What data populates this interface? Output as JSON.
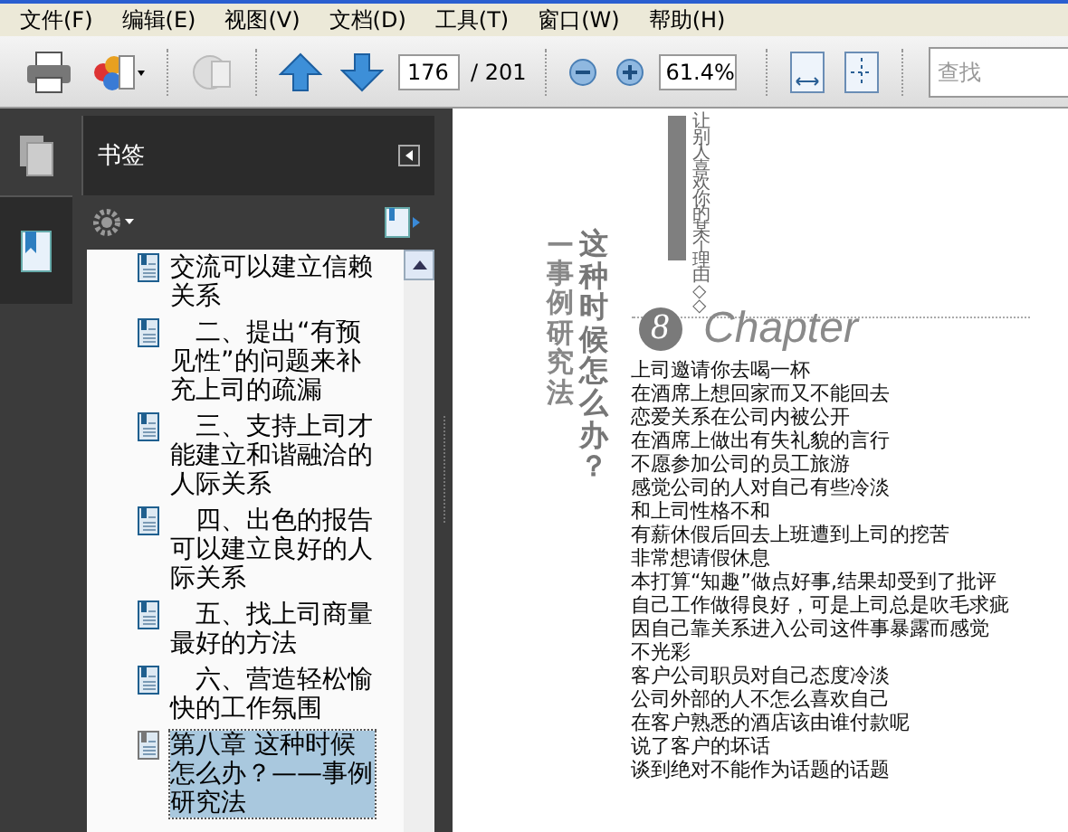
{
  "menu": [
    {
      "label": "文件(F)"
    },
    {
      "label": "编辑(E)"
    },
    {
      "label": "视图(V)"
    },
    {
      "label": "文档(D)"
    },
    {
      "label": "工具(T)"
    },
    {
      "label": "窗口(W)"
    },
    {
      "label": "帮助(H)"
    }
  ],
  "toolbar": {
    "page_number": "176",
    "page_total": "/ 201",
    "zoom": "61.4%",
    "search": {
      "placeholder": "查找"
    }
  },
  "nav_panel": [
    {
      "kind": "pages",
      "selected": false
    },
    {
      "kind": "bookmarks",
      "selected": true
    }
  ],
  "bookmarks_panel": {
    "title": "书签",
    "items": [
      {
        "label": "交流可以建立信赖关系",
        "indent": false,
        "selected": false
      },
      {
        "label": "二、提出“有预见性”的问题来补充上司的疏漏",
        "indent": true,
        "selected": false
      },
      {
        "label": "三、支持上司才能建立和谐融洽的人际关系",
        "indent": true,
        "selected": false
      },
      {
        "label": "四、出色的报告可以建立良好的人际关系",
        "indent": true,
        "selected": false
      },
      {
        "label": "五、找上司商量最好的方法",
        "indent": true,
        "selected": false
      },
      {
        "label": "六、营造轻松愉快的工作氛围",
        "indent": true,
        "selected": false
      },
      {
        "label": "第八章 这种时候怎么办？——事例研究法",
        "indent": false,
        "selected": true
      }
    ]
  },
  "page": {
    "side_note": "让别人喜欢你的某个理由◇◇",
    "title": "这种时候怎么办？",
    "subtitle": "—事例研究法",
    "chapter_number": "8",
    "chapter_label": "Chapter",
    "lines": [
      "上司邀请你去喝一杯",
      "在酒席上想回家而又不能回去",
      "恋爱关系在公司内被公开",
      "在酒席上做出有失礼貌的言行",
      "不愿参加公司的员工旅游",
      "感觉公司的人对自己有些冷淡",
      "和上司性格不和",
      "有薪休假后回去上班遭到上司的挖苦",
      "非常想请假休息",
      "本打算“知趣”做点好事,结果却受到了批评",
      "自己工作做得良好，可是上司总是吹毛求疵",
      "因自己靠关系进入公司这件事暴露而感觉",
      "不光彩",
      "客户公司职员对自己态度冷淡",
      "公司外部的人不怎么喜欢自己",
      "在客户熟悉的酒店该由谁付款呢",
      "说了客户的坏话",
      "谈到绝对不能作为话题的话题"
    ]
  }
}
